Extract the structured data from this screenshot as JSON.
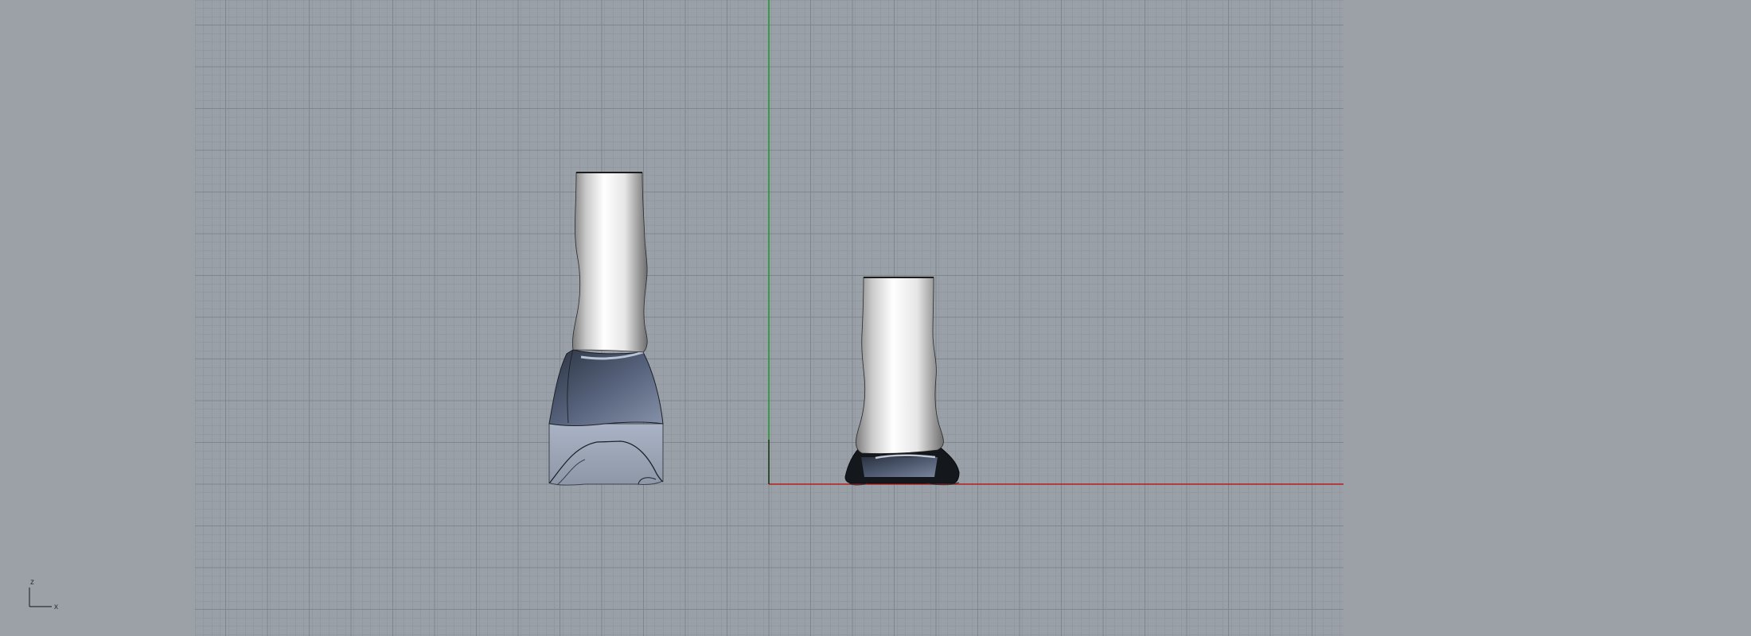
{
  "viewport": {
    "view": "Front",
    "background_color": "#9ca1a8",
    "grid_color": "#888d95",
    "grid_major_color": "#7f858d",
    "world_x_axis_color": "#b41e1e",
    "world_y_axis_color": "#1f9a2a"
  },
  "axis_widget": {
    "vertical_label": "z",
    "horizontal_label": "x"
  },
  "objects": [
    {
      "name": "tall-vase"
    },
    {
      "name": "short-vase"
    }
  ]
}
